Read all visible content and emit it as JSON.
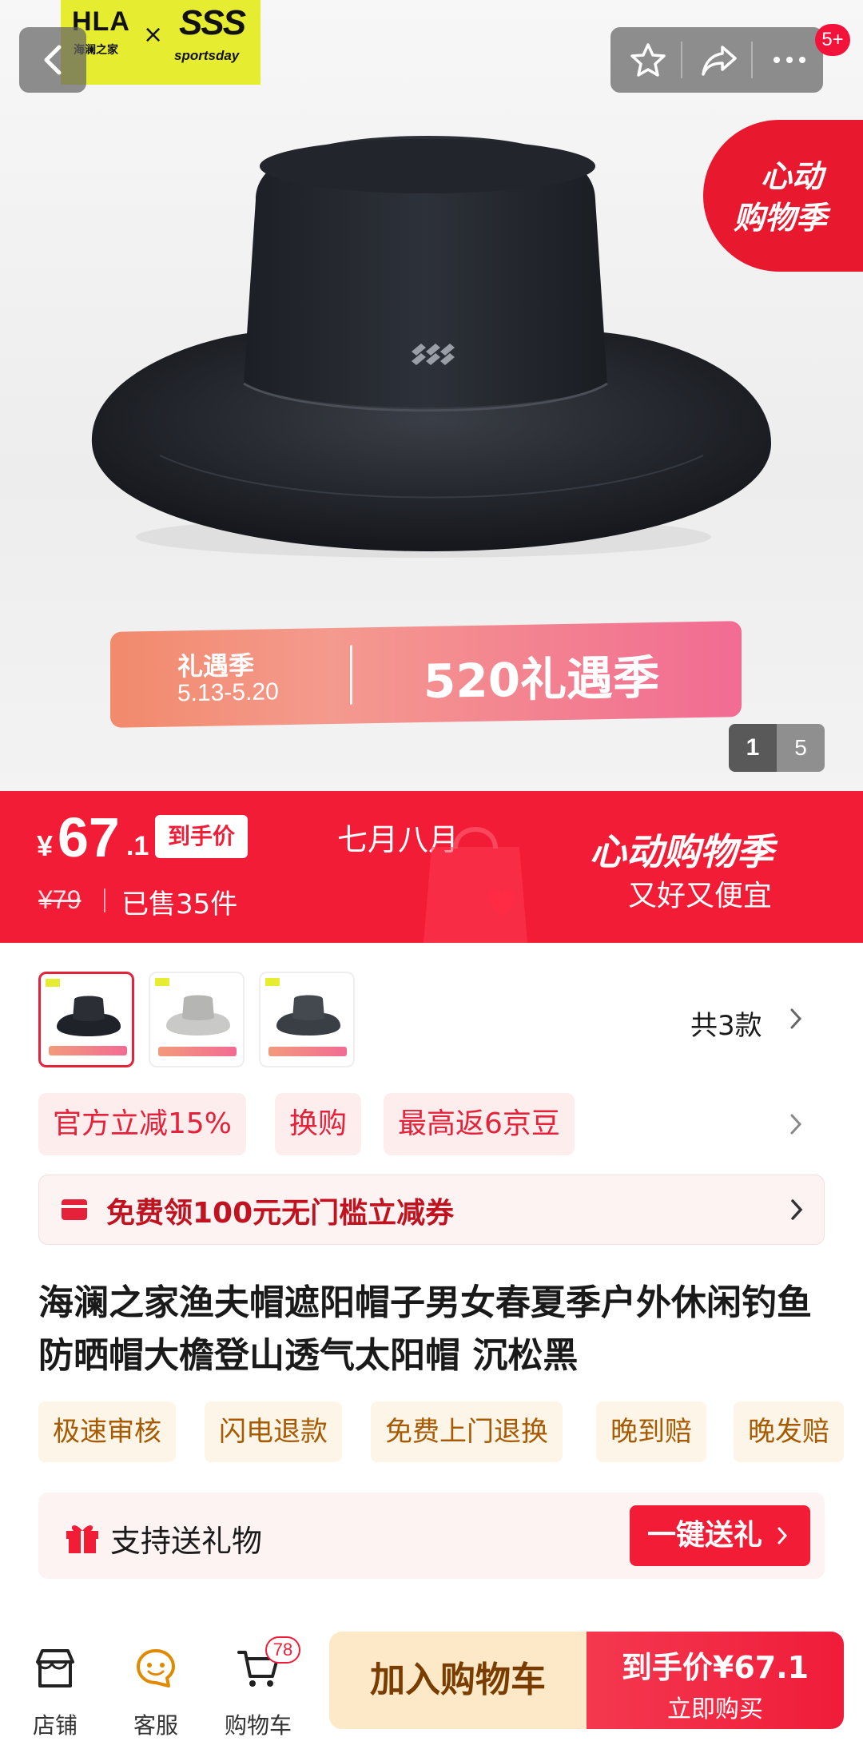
{
  "brand": {
    "left": "HLA",
    "left_sub": "海澜之家",
    "x": "×",
    "right_logo": "SSS",
    "right_name": "sportsday"
  },
  "notifications": "5+",
  "promo_badge": {
    "line1": "心动",
    "line2": "购物季"
  },
  "ribbon": {
    "title": "礼遇季",
    "date": "5.13-5.20",
    "big": "520礼遇季"
  },
  "pager": {
    "current": "1",
    "total": "5"
  },
  "price": {
    "currency": "¥",
    "main": "67",
    "decimal": ".1",
    "tag": "到手价",
    "original": "¥79",
    "sold": "已售35件",
    "mid_text": "七月八月",
    "band_title": "心动购物季",
    "band_sub": "又好又便宜"
  },
  "variants": {
    "count_label": "共3款",
    "colors": [
      "#1f2229",
      "#c9c9c7",
      "#3a3e45"
    ]
  },
  "promos": [
    "官方立减15%",
    "换购",
    "最高返6京豆"
  ],
  "coupon": "免费领100元无门槛立减券",
  "title": "海澜之家渔夫帽遮阳帽子男女春夏季户外休闲钓鱼防晒帽大檐登山透气太阳帽 沉松黑",
  "services": [
    "极速审核",
    "闪电退款",
    "免费上门退换",
    "晚到赔",
    "晚发赔"
  ],
  "gift": {
    "text": "支持送礼物",
    "button": "一键送礼"
  },
  "bottom": {
    "store": "店铺",
    "service": "客服",
    "cart": "购物车",
    "cart_count": "78",
    "add_cart": "加入购物车",
    "buy_line1": "到手价¥67.1",
    "buy_line2": "立即购买"
  },
  "colors": {
    "accent": "#f21c36",
    "brand_yellow": "#e6ec2f",
    "cart_btn": "#fde8c7"
  },
  "icons": [
    "back-icon",
    "star-icon",
    "share-icon",
    "more-icon",
    "chevron-right-icon",
    "coupon-icon",
    "gift-icon",
    "store-icon",
    "customer-service-icon",
    "cart-icon"
  ]
}
